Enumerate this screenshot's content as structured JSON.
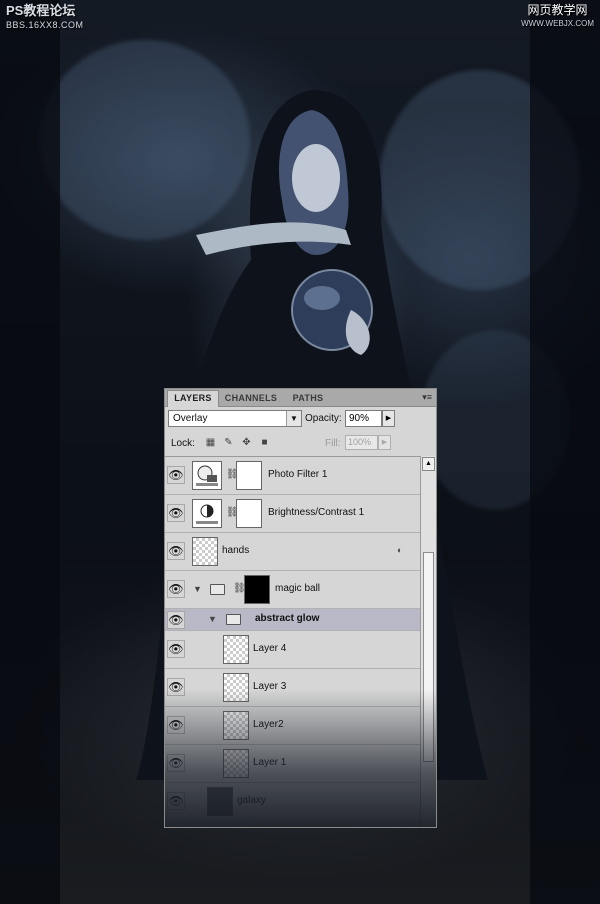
{
  "watermark": {
    "left_title": "PS教程论坛",
    "left_sub": "BBS.16XX8.COM",
    "right_title": "网页教学网",
    "right_sub": "WWW.WEBJX.COM"
  },
  "panel": {
    "tabs": [
      {
        "label": "LAYERS",
        "active": true
      },
      {
        "label": "CHANNELS",
        "active": false
      },
      {
        "label": "PATHS",
        "active": false
      }
    ],
    "menu_icon": "panel-menu-icon",
    "blend_mode": "Overlay",
    "opacity_label": "Opacity:",
    "opacity_value": "90%",
    "lock_label": "Lock:",
    "fill_label": "Fill:",
    "fill_value": "100%",
    "layers": [
      {
        "name": "Photo Filter 1",
        "type": "adjustment",
        "thumb_icon": "photo-filter-icon",
        "visible": true
      },
      {
        "name": "Brightness/Contrast 1",
        "type": "adjustment",
        "thumb_icon": "brightness-contrast-icon",
        "visible": true
      },
      {
        "name": "hands",
        "type": "smart-object",
        "visible": true
      },
      {
        "name": "magic ball",
        "type": "group",
        "visible": true,
        "expanded": true
      },
      {
        "name": "abstract glow",
        "type": "group",
        "visible": true,
        "expanded": true,
        "selected": true
      },
      {
        "name": "Layer 4",
        "type": "pixel",
        "visible": true
      },
      {
        "name": "Layer 3",
        "type": "pixel",
        "visible": true
      },
      {
        "name": "Layer2",
        "type": "pixel",
        "visible": true
      },
      {
        "name": "Layer 1",
        "type": "pixel",
        "visible": true
      },
      {
        "name": "galaxy",
        "type": "pixel",
        "visible": true
      }
    ]
  },
  "colors": {
    "panel_bg": "#d6d6d6",
    "selected_row": "#b8b8c6",
    "scene_dark": "#0c1018"
  }
}
